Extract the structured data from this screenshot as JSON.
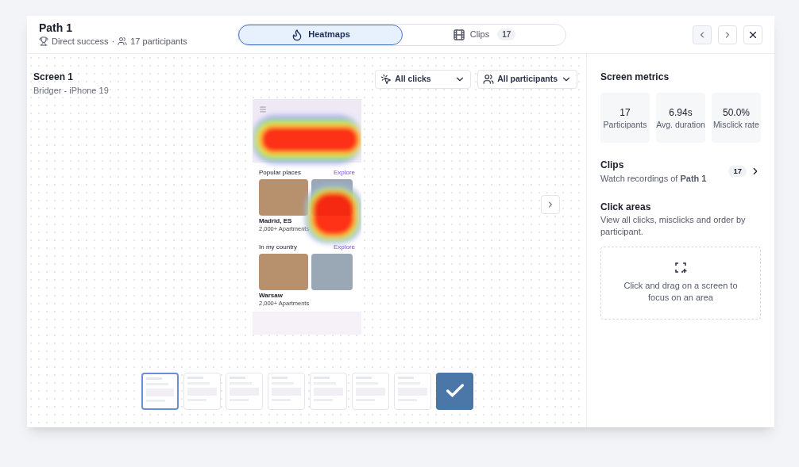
{
  "header": {
    "title": "Path 1",
    "outcome": "Direct success",
    "separator": "·",
    "participants": "17 participants"
  },
  "view_tabs": [
    {
      "kind": "heatmap",
      "label": "Heatmaps",
      "selected": true
    },
    {
      "kind": "clips",
      "label": "Clips",
      "badge": "17",
      "selected": false
    }
  ],
  "screen": {
    "title": "Screen 1",
    "device": "Bridger - iPhone 19",
    "filters": [
      {
        "kind": "clicks",
        "label": "All clicks"
      },
      {
        "kind": "participants",
        "label": "All participants"
      }
    ]
  },
  "phone": {
    "sections": [
      {
        "heading": "Popular places",
        "link": "Explore",
        "cards": [
          {
            "name": "Madrid, ES",
            "meta": "2,000+ Apartments"
          }
        ]
      },
      {
        "heading": "In my country",
        "link": "Explore",
        "cards": [
          {
            "name": "Warsaw",
            "meta": "2,000+ Apartments"
          }
        ]
      }
    ]
  },
  "thumbnails": [
    {
      "kind": "screen",
      "selected": true
    },
    {
      "kind": "screen",
      "selected": false
    },
    {
      "kind": "screen",
      "selected": false
    },
    {
      "kind": "screen",
      "selected": false
    },
    {
      "kind": "screen",
      "selected": false
    },
    {
      "kind": "screen",
      "selected": false
    },
    {
      "kind": "screen",
      "selected": false
    },
    {
      "kind": "success",
      "selected": false
    }
  ],
  "metrics": {
    "title": "Screen metrics",
    "items": [
      {
        "value": "17",
        "label": "Participants"
      },
      {
        "value": "6.94s",
        "label": "Avg. duration"
      },
      {
        "value": "50.0%",
        "label": "Misclick rate"
      }
    ]
  },
  "clips": {
    "title": "Clips",
    "description": "Watch recordings of **Path 1**",
    "count": "17"
  },
  "click_areas": {
    "title": "Click areas",
    "description": "View all clicks, misclicks and order by participant.",
    "hint": "Click and drag on a screen to focus on an area"
  }
}
